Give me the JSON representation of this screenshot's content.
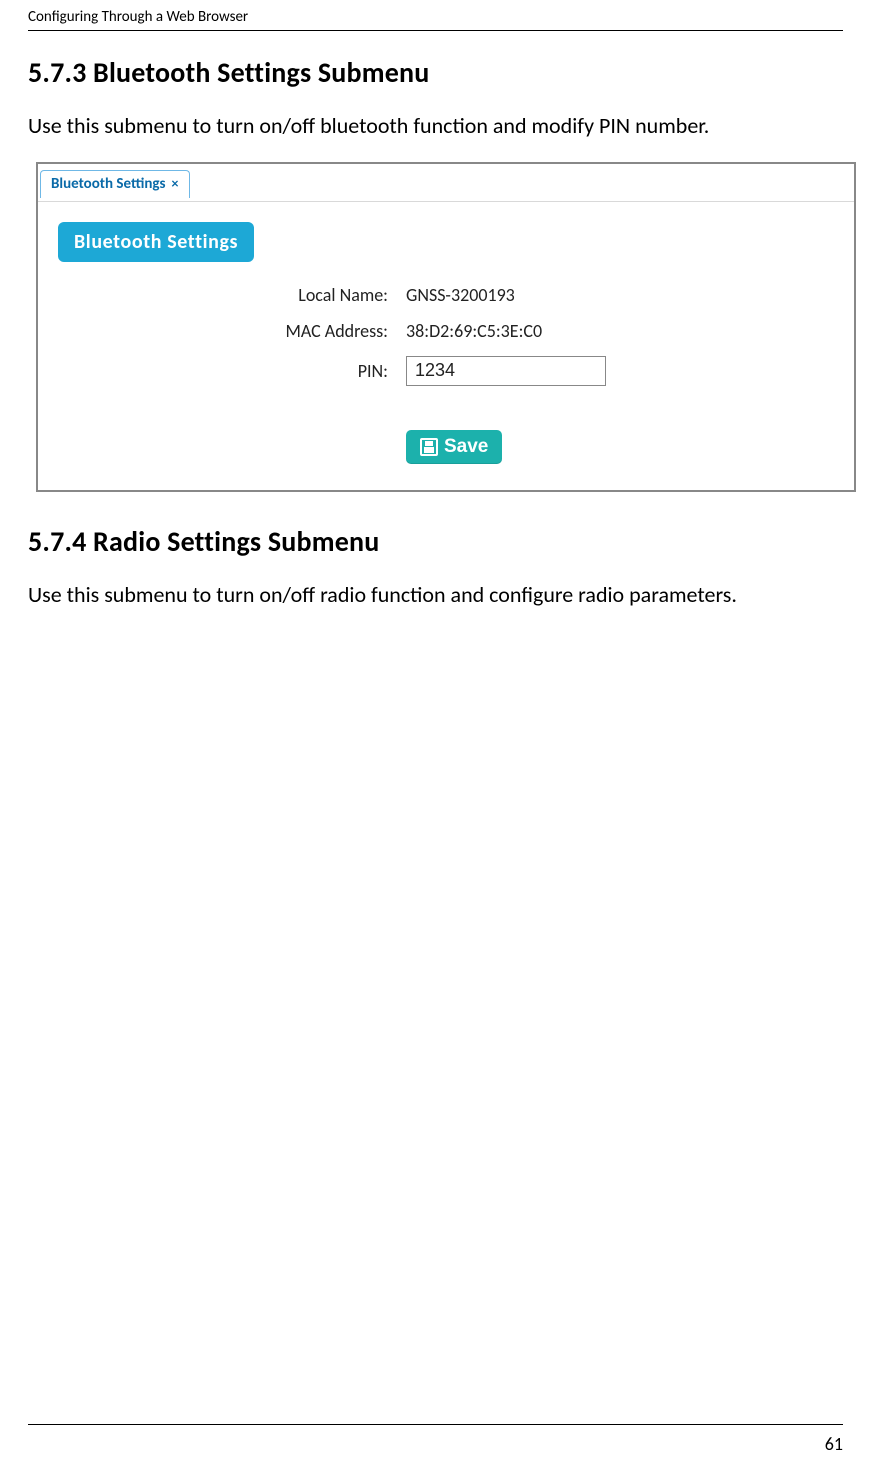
{
  "header": {
    "running": "Configuring Through a Web Browser"
  },
  "sections": {
    "s573": {
      "title": "5.7.3 Bluetooth Settings Submenu",
      "intro": "Use this submenu to turn on/off bluetooth function and modify PIN number."
    },
    "s574": {
      "title": "5.7.4 Radio Settings Submenu",
      "intro": "Use this submenu to turn on/off radio function and configure radio parameters."
    }
  },
  "screenshot": {
    "tab": {
      "label": "Bluetooth Settings",
      "close": "×"
    },
    "badge": "Bluetooth  Settings",
    "fields": {
      "local_name": {
        "label": "Local Name:",
        "value": "GNSS-3200193"
      },
      "mac_address": {
        "label": "MAC Address:",
        "value": "38:D2:69:C5:3E:C0"
      },
      "pin": {
        "label": "PIN:",
        "value": "1234"
      }
    },
    "save_label": "Save"
  },
  "footer": {
    "page_number": "61"
  }
}
